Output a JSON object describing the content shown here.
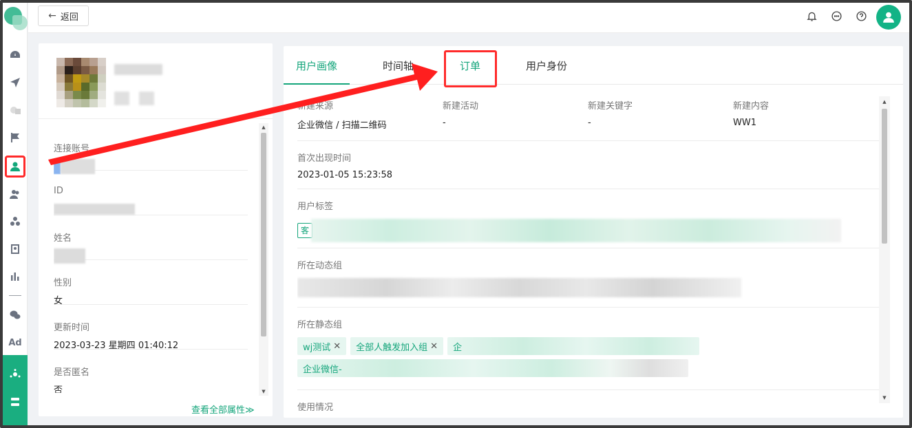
{
  "header": {
    "back_label": "返回"
  },
  "tabs": [
    {
      "label": "用户画像",
      "active": true
    },
    {
      "label": "时间轴",
      "active": false
    },
    {
      "label": "订单",
      "active": false,
      "highlighted": true
    },
    {
      "label": "用户身份",
      "active": false
    }
  ],
  "profile_fields": [
    {
      "label": "连接账号",
      "value": ""
    },
    {
      "label": "ID",
      "value": ""
    },
    {
      "label": "姓名",
      "value": ""
    },
    {
      "label": "性别",
      "value": "女"
    },
    {
      "label": "更新时间",
      "value": "2023-03-23 星期四 01:40:12"
    },
    {
      "label": "是否匿名",
      "value": "否"
    }
  ],
  "view_all_label": "查看全部属性≫",
  "source": {
    "cols": [
      {
        "label": "新建来源",
        "value": "企业微信 / 扫描二维码"
      },
      {
        "label": "新建活动",
        "value": "-"
      },
      {
        "label": "新建关键字",
        "value": "-"
      },
      {
        "label": "新建内容",
        "value": "WW1"
      }
    ]
  },
  "first_seen": {
    "label": "首次出现时间",
    "value": "2023-01-05 15:23:58"
  },
  "user_tags": {
    "label": "用户标签",
    "first_tag": "客"
  },
  "dynamic_group": {
    "label": "所在动态组"
  },
  "static_group": {
    "label": "所在静态组",
    "chips": [
      "wj测试",
      "全部人触发加入组"
    ],
    "chip_partial_1": "企",
    "chip_partial_2": "企业微信-"
  },
  "usage": {
    "label": "使用情况"
  },
  "colors": {
    "accent": "#14a57b",
    "highlight": "#ff2a2a",
    "rail_bottom": "#1aae80"
  }
}
